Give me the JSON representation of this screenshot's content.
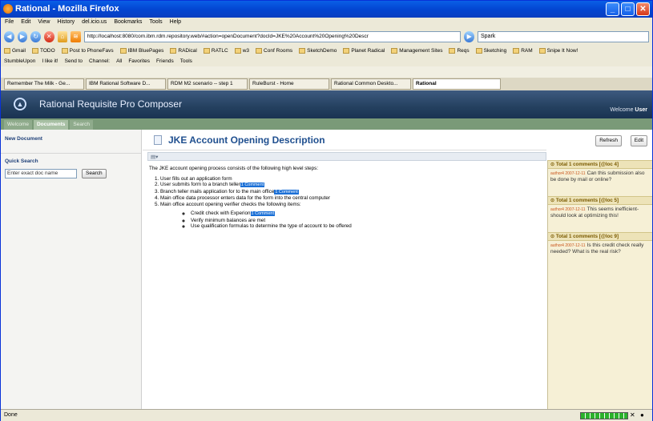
{
  "window": {
    "title": "Rational - Mozilla Firefox"
  },
  "menu": [
    "File",
    "Edit",
    "View",
    "History",
    "del.icio.us",
    "Bookmarks",
    "Tools",
    "Help"
  ],
  "nav": {
    "url": "http://localhost:8080/com.ibm.rdm.repository.web/#action=openDocument?docId=JKE%20Account%20Opening%20Descr",
    "search_value": "Spark"
  },
  "bookmarks": [
    "Gmail",
    "TODO",
    "Post to PhoneFavs",
    "IBM BluePages",
    "RADical",
    "RATLC",
    "w3",
    "Conf Rooms",
    "SketchDemo",
    "Planet Radical",
    "Management Sites",
    "Reqs",
    "Sketching",
    "RAM",
    "Snipe It Now!"
  ],
  "toolbar2": [
    "StumbleUpon",
    "I like it!",
    "Send to",
    "Channel:",
    "All",
    "Favorites",
    "Friends",
    "Tools"
  ],
  "browser_tabs": [
    "Remember The Milk - Ge...",
    "IBM Rational Software D...",
    "RDM M2 scenario -- step 1",
    "RuleBurst - Home",
    "Rational Common Deskto...",
    "Rational"
  ],
  "app": {
    "title": "Rational Requisite Pro Composer",
    "welcome_prefix": "Welcome",
    "welcome_user": "User",
    "tabs": [
      "Welcome",
      "Documents",
      "Search"
    ]
  },
  "left": {
    "new_document": "New Document",
    "quick_search": "Quick Search",
    "search_placeholder": "Enter exact doc name",
    "search_button": "Search"
  },
  "document": {
    "title": "JKE Account Opening Description",
    "refresh": "Refresh",
    "edit": "Edit",
    "intro": "The JKE account opening process consists of the following high level steps:",
    "steps": [
      "User fills out an application form",
      "User submits form to a branch teller",
      "Branch teller mails application for to the main office",
      "Main office data processor enters data for the form into the central computer",
      "Main office account opening verifier checks the following items:"
    ],
    "sub_items": [
      "Credit check with Experion",
      "Verify minimum balances are met",
      "Use qualification formulas to determine the type of account to be offered"
    ],
    "comment_tag": "1 Comment"
  },
  "comments": [
    {
      "head": "Total 1 comments [@loc 4]",
      "author": "author4 2007-12-11",
      "text": "Can this submission also be done by mail or online?"
    },
    {
      "head": "Total 1 comments [@loc 5]",
      "author": "author4 2007-12-11",
      "text": "This seems inefficient- should look at optimizing this!"
    },
    {
      "head": "Total 1 comments [@loc 9]",
      "author": "author4 2007-12-11",
      "text": "Is this credit check really needed? What is the real risk?"
    }
  ],
  "status": {
    "text": "Done"
  }
}
